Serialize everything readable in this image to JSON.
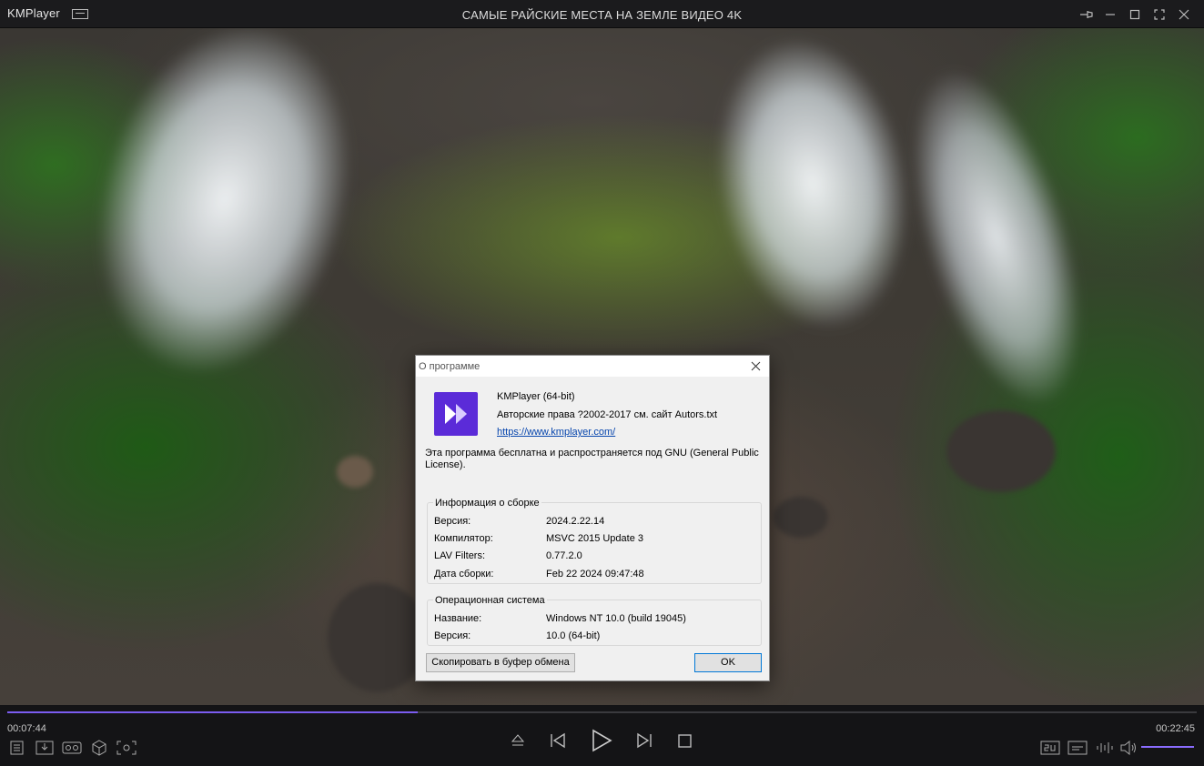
{
  "window": {
    "app_name": "KMPlayer",
    "title": "САМЫЕ РАЙСКИЕ МЕСТА НА ЗЕМЛЕ ВИДЕО 4K"
  },
  "dialog": {
    "title": "О программе",
    "product": "KMPlayer (64-bit)",
    "copyright": "Авторские права ?2002-2017 см. сайт Autors.txt",
    "website": "https://www.kmplayer.com/",
    "license": "Эта программа бесплатна и распространяется под GNU (General Public License).",
    "build_info": {
      "title": "Информация о сборке",
      "rows": [
        {
          "label": "Версия:",
          "value": "2024.2.22.14"
        },
        {
          "label": "Компилятор:",
          "value": "MSVC 2015 Update 3"
        },
        {
          "label": "LAV Filters:",
          "value": "0.77.2.0"
        },
        {
          "label": "Дата сборки:",
          "value": "Feb 22 2024 09:47:48"
        }
      ]
    },
    "os_info": {
      "title": "Операционная система",
      "rows": [
        {
          "label": "Название:",
          "value": "Windows NT 10.0 (build 19045)"
        },
        {
          "label": "Версия:",
          "value": "10.0 (64-bit)"
        }
      ]
    },
    "copy_button": "Скопировать в буфер обмена",
    "ok_button": "OK"
  },
  "player": {
    "elapsed": "00:07:44",
    "total": "00:22:45",
    "progress_fraction": 0.345,
    "volume_fraction": 1.0
  },
  "colors": {
    "accent": "#7b5cf0",
    "app_icon": "#5b2bd8",
    "link": "#0645ad"
  }
}
